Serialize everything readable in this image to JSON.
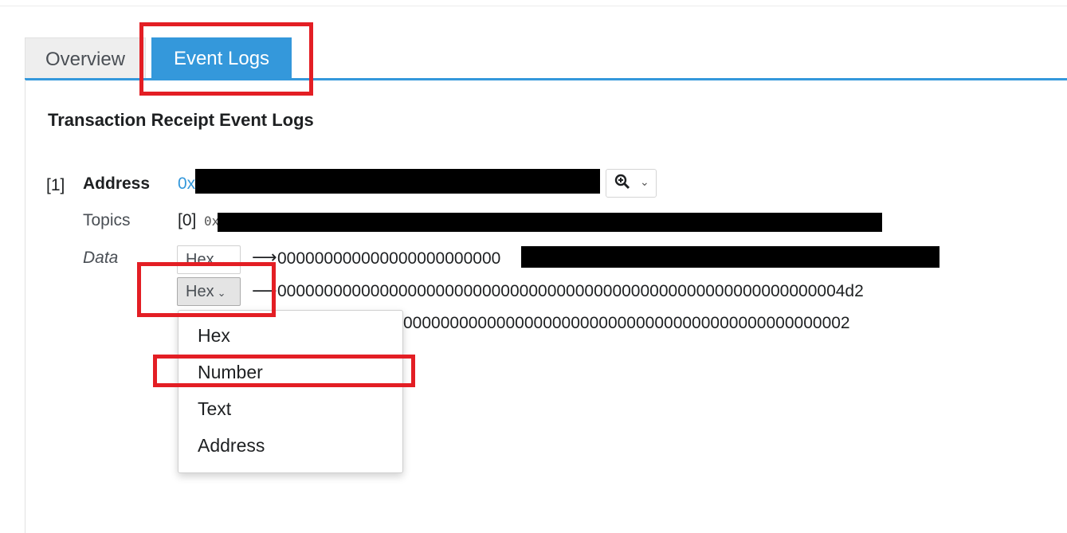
{
  "tabs": [
    {
      "label": "Overview",
      "active": false
    },
    {
      "label": "Event Logs",
      "active": true
    }
  ],
  "section_title": "Transaction Receipt Event Logs",
  "log": {
    "index": "[1]",
    "address_label": "Address",
    "address_prefix": "0x",
    "topics_label": "Topics",
    "topic_index": "[0]",
    "topic_prefix": "0x",
    "data_label": "Data",
    "rows": [
      {
        "format": "Hex",
        "value": "000000000000000000000000"
      },
      {
        "format": "Hex",
        "value": "0000000000000000000000000000000000000000000000000000000000004d2"
      },
      {
        "value": "000000000000000000000000000000000000000000000002"
      }
    ]
  },
  "icons": {
    "zoom": "zoom-in-icon",
    "chevron": "chevron-down-icon",
    "arrow": "arrow-right-icon"
  },
  "dropdown": {
    "options": [
      "Hex",
      "Number",
      "Text",
      "Address"
    ]
  },
  "colors": {
    "accent": "#3498db",
    "highlight": "#e31e24",
    "redaction": "#000000"
  }
}
